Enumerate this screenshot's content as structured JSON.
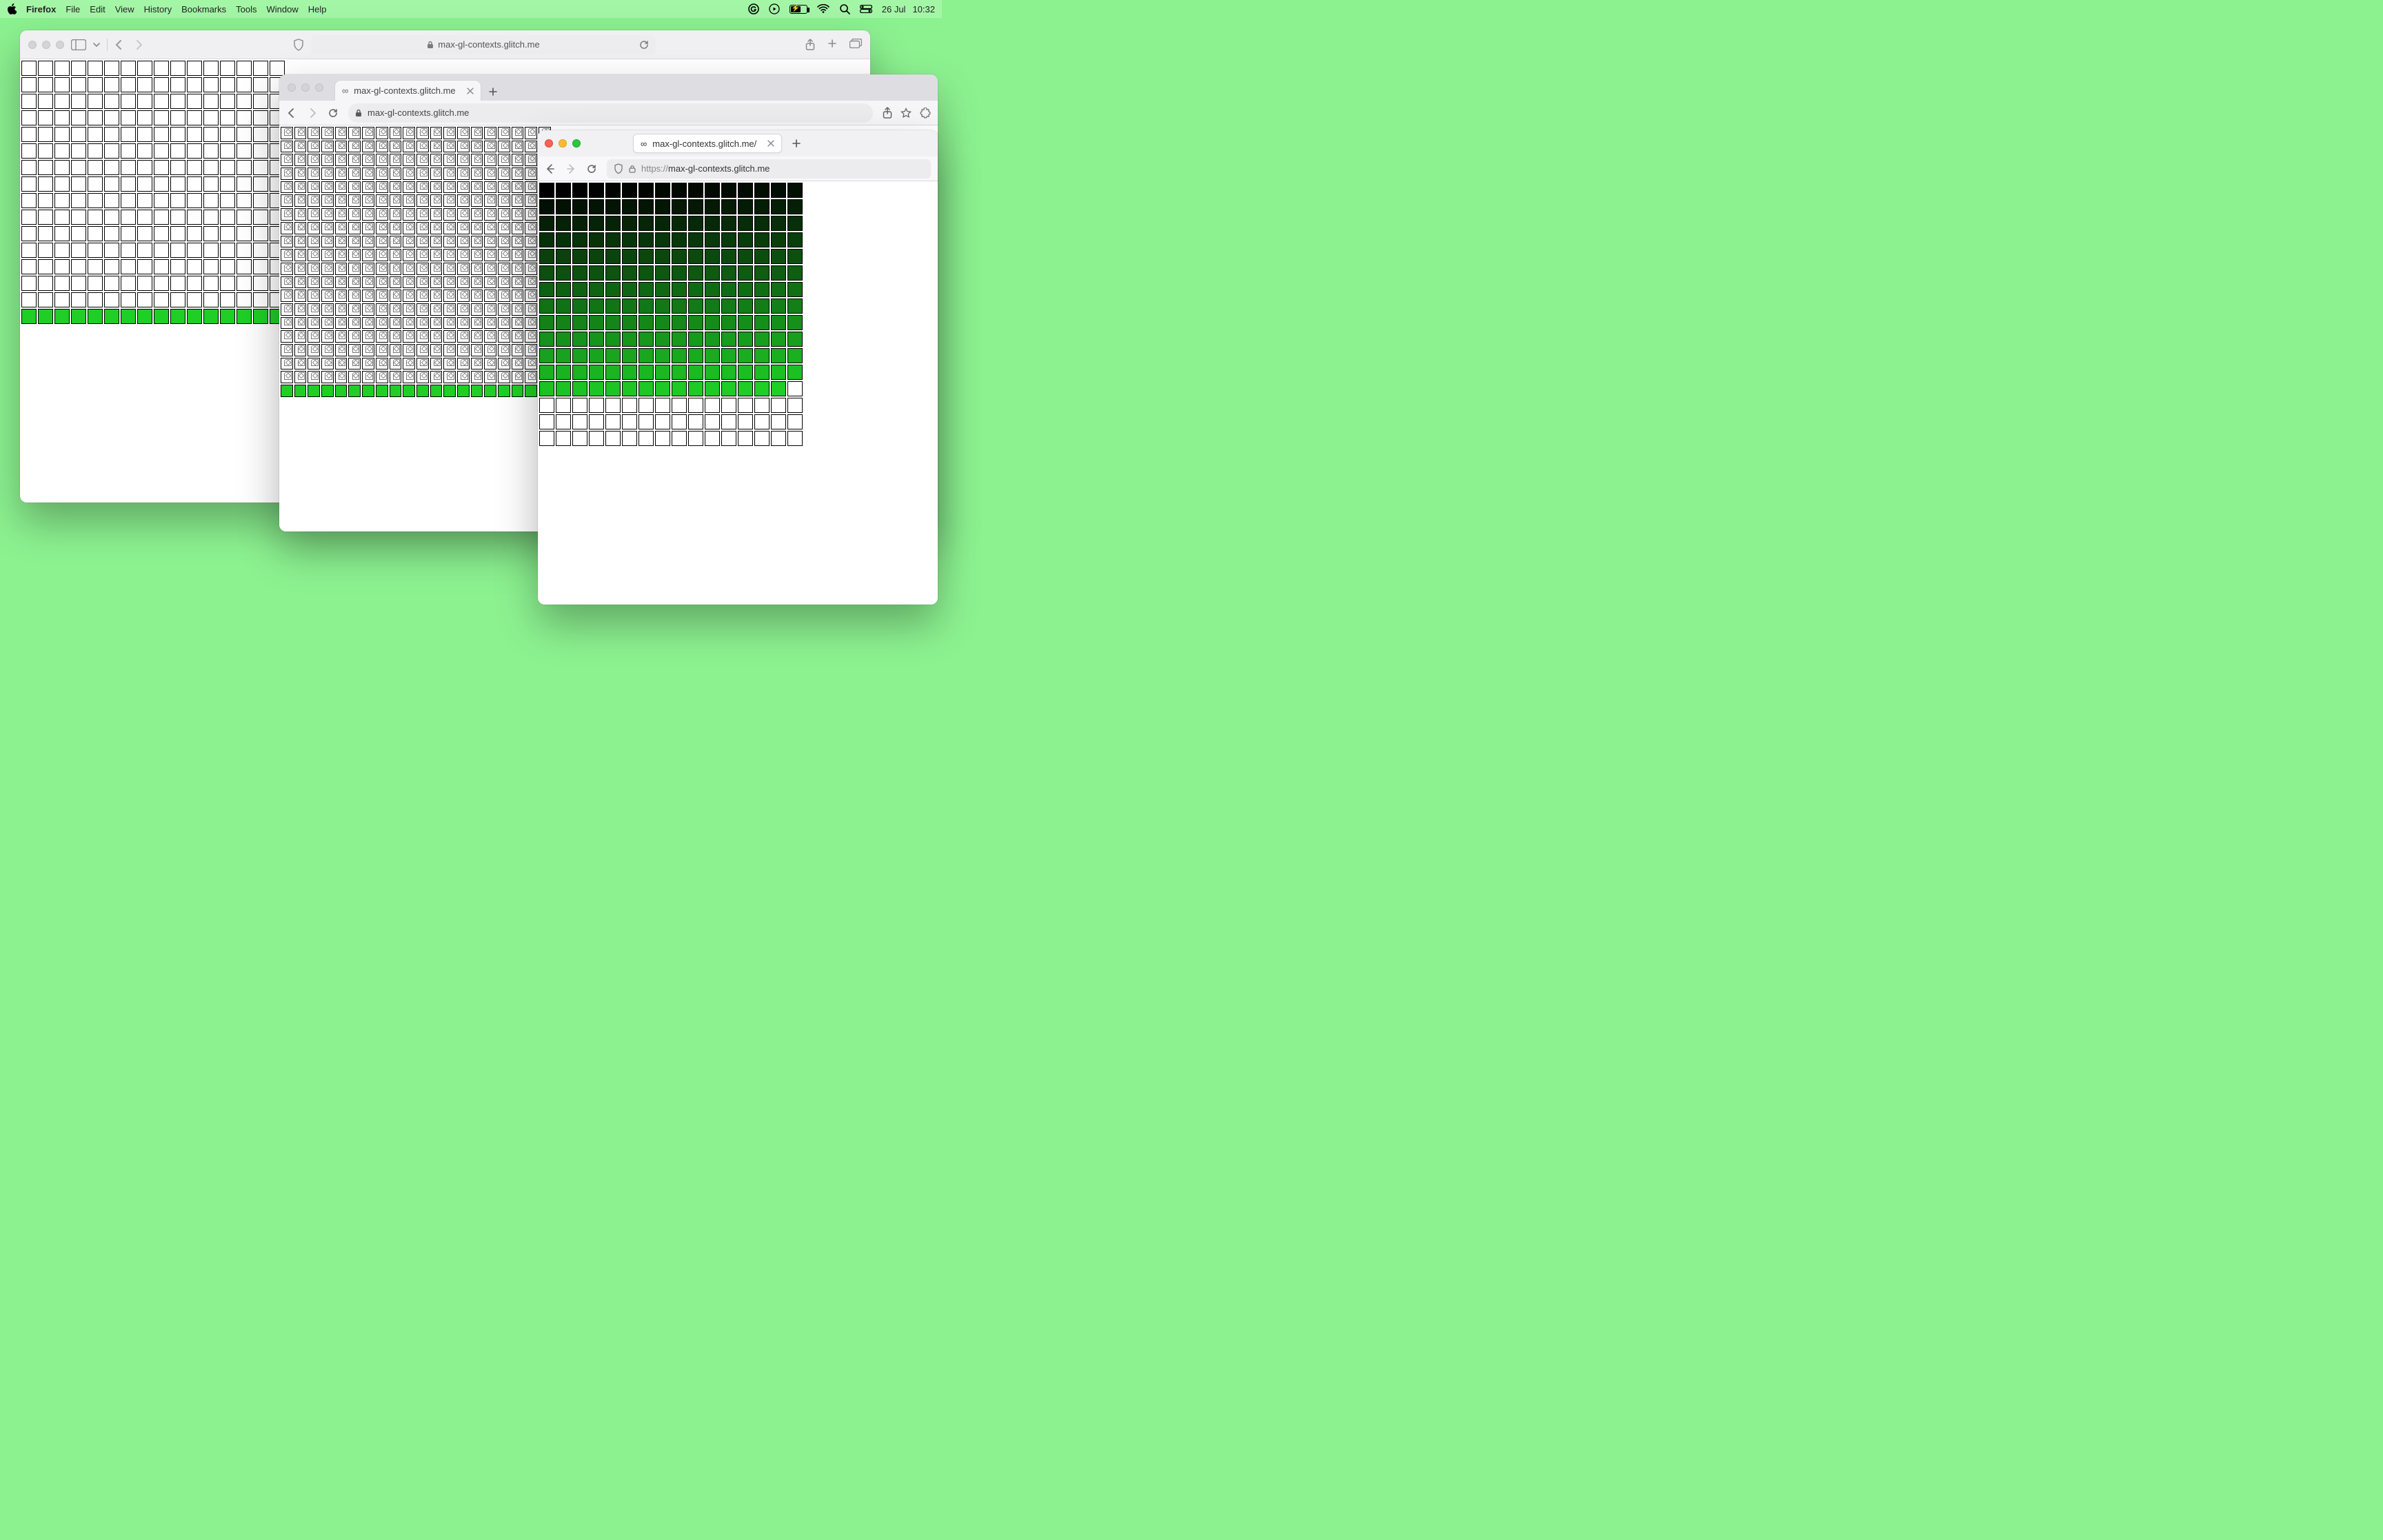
{
  "menubar": {
    "app_name": "Firefox",
    "items": [
      "File",
      "Edit",
      "View",
      "History",
      "Bookmarks",
      "Tools",
      "Window",
      "Help"
    ],
    "date": "26 Jul",
    "time": "10:32"
  },
  "safari": {
    "url_text": "max-gl-contexts.glitch.me",
    "grid": {
      "cols": 16,
      "rows": 16,
      "green_rows_from_bottom": 1
    }
  },
  "chrome": {
    "tab_title": "max-gl-contexts.glitch.me",
    "url_text": "max-gl-contexts.glitch.me",
    "grid": {
      "cols": 20,
      "rows": 20,
      "green_rows_from_bottom": 1
    }
  },
  "firefox": {
    "tab_title": "max-gl-contexts.glitch.me/",
    "url_protocol": "https://",
    "url_host": "max-gl-contexts.glitch.me",
    "grid": {
      "cols": 16,
      "rows": 16,
      "filled_cells": 207
    }
  }
}
